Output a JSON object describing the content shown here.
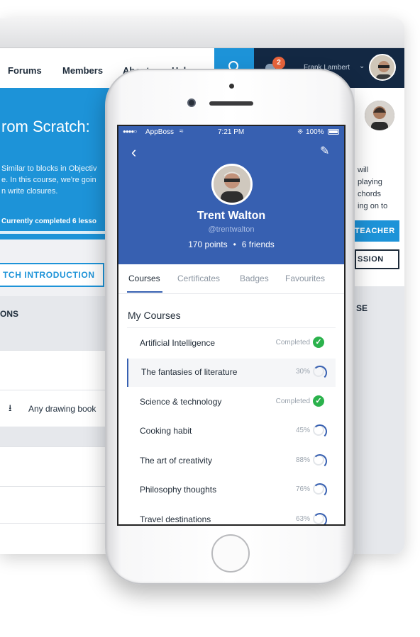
{
  "desktop": {
    "nav": [
      "Forums",
      "Members",
      "About",
      "Help"
    ],
    "user": {
      "name": "Frank Lambert",
      "notifications": "2"
    },
    "hero": {
      "title": "rom Scratch: ",
      "text_lines": [
        "Similar to blocks in Objectiv",
        "e. In this course, we're goin",
        "n write closures."
      ],
      "progress_text": "Currently completed 6 lesso"
    },
    "intro_button": "TCH INTRODUCTION",
    "lessons_label": "ONS",
    "download_item": "Any drawing book",
    "right_panel": {
      "text_lines": [
        "will",
        "playing",
        "chords",
        "ing on to"
      ],
      "teacher_button": "TEACHER",
      "session_button": "SSION",
      "section_label": "SE"
    }
  },
  "phone": {
    "status": {
      "carrier": "AppBoss",
      "time": "7:21 PM",
      "battery": "100%"
    },
    "profile": {
      "name": "Trent Walton",
      "handle": "@trentwalton",
      "points": "170 points",
      "separator": "•",
      "friends": "6 friends"
    },
    "tabs": [
      "Courses",
      "Certificates",
      "Badges",
      "Favourites"
    ],
    "active_tab": "Courses",
    "section_title": "My Courses",
    "courses": [
      {
        "name": "Artificial Intelligence",
        "status": "Completed",
        "completed": true
      },
      {
        "name": "The fantasies of literature",
        "status": "30%",
        "completed": false,
        "selected": true
      },
      {
        "name": "Science & technology",
        "status": "Completed",
        "completed": true
      },
      {
        "name": "Cooking habit",
        "status": "45%",
        "completed": false
      },
      {
        "name": "The art of creativity",
        "status": "88%",
        "completed": false
      },
      {
        "name": "Philosophy thoughts",
        "status": "76%",
        "completed": false
      },
      {
        "name": "Travel destinations",
        "status": "63%",
        "completed": false
      }
    ]
  },
  "icons": {
    "back": "back-arrow-icon",
    "edit": "pencil-icon",
    "check": "check-icon",
    "download": "download-icon",
    "search": "search-icon",
    "bell": "bell-icon"
  },
  "colors": {
    "header_blue": "#3760b1",
    "desktop_blue": "#1d93d8",
    "navy": "#132843",
    "complete_green": "#2bb24c"
  }
}
